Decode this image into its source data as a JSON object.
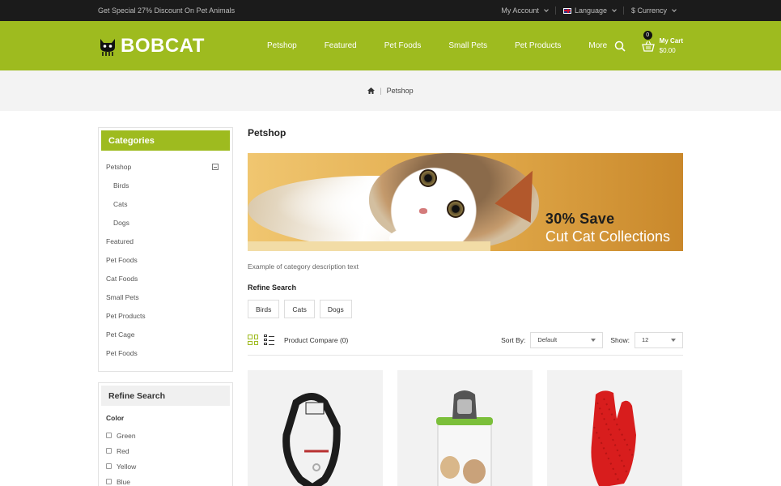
{
  "topbar": {
    "promo": "Get Special 27% Discount On Pet Animals",
    "my_account": "My Account",
    "language": "Language",
    "currency": "$ Currency"
  },
  "header": {
    "logo_text": "BOBCAT",
    "nav": [
      "Petshop",
      "Featured",
      "Pet Foods",
      "Small Pets",
      "Pet Products",
      "More"
    ],
    "cart_count": "0",
    "cart_label": "My Cart",
    "cart_total": "$0.00"
  },
  "breadcrumb": {
    "current": "Petshop"
  },
  "sidebar": {
    "categories_title": "Categories",
    "categories": [
      {
        "label": "Petshop"
      },
      {
        "label": "Birds"
      },
      {
        "label": "Cats"
      },
      {
        "label": "Dogs"
      },
      {
        "label": "Featured"
      },
      {
        "label": "Pet Foods"
      },
      {
        "label": "Cat Foods"
      },
      {
        "label": "Small Pets"
      },
      {
        "label": "Pet Products"
      },
      {
        "label": "Pet Cage"
      },
      {
        "label": "Pet Foods"
      }
    ],
    "refine_title": "Refine Search",
    "color_label": "Color",
    "colors": [
      "Green",
      "Red",
      "Yellow",
      "Blue"
    ]
  },
  "content": {
    "title": "Petshop",
    "banner_line1": "30% Save",
    "banner_line2": "Cut Cat Collections",
    "description": "Example of category description text",
    "refine_title": "Refine Search",
    "refine_chips": [
      "Birds",
      "Cats",
      "Dogs"
    ],
    "compare": "Product Compare (0)",
    "sort_label": "Sort By:",
    "sort_value": "Default",
    "show_label": "Show:",
    "show_value": "12"
  },
  "colors": {
    "brand": "#9ebb1f",
    "topbar": "#1b1b1b"
  }
}
